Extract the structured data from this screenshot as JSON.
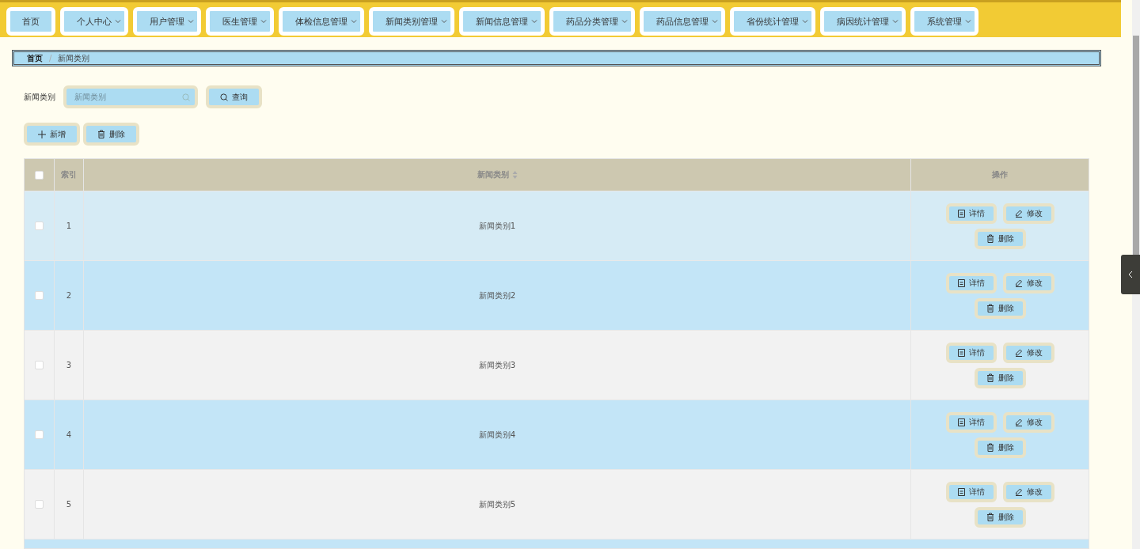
{
  "nav": [
    {
      "label": "首页",
      "has_menu": false
    },
    {
      "label": "个人中心",
      "has_menu": true
    },
    {
      "label": "用户管理",
      "has_menu": true
    },
    {
      "label": "医生管理",
      "has_menu": true
    },
    {
      "label": "体检信息管理",
      "has_menu": true
    },
    {
      "label": "新闻类别管理",
      "has_menu": true
    },
    {
      "label": "新闻信息管理",
      "has_menu": true
    },
    {
      "label": "药品分类管理",
      "has_menu": true
    },
    {
      "label": "药品信息管理",
      "has_menu": true
    },
    {
      "label": "省份统计管理",
      "has_menu": true
    },
    {
      "label": "病因统计管理",
      "has_menu": true
    },
    {
      "label": "系统管理",
      "has_menu": true
    }
  ],
  "breadcrumb": [
    "首页",
    "新闻类别"
  ],
  "breadcrumb_separator": "/",
  "search": {
    "label": "新闻类别",
    "placeholder": "新闻类别",
    "button": "查询"
  },
  "toolbar": [
    {
      "kind": "add",
      "label": "新增"
    },
    {
      "kind": "delete",
      "label": "删除"
    }
  ],
  "table": {
    "header_checked": false,
    "columns": [
      "索引",
      "新闻类别",
      "操作"
    ],
    "rows": [
      {
        "checked": false,
        "index": "1",
        "name": "新闻类别1",
        "actions": [
          {
            "kind": "detail",
            "label": "详情"
          },
          {
            "kind": "edit",
            "label": "修改"
          },
          {
            "kind": "delete",
            "label": "删除"
          }
        ]
      },
      {
        "checked": false,
        "index": "2",
        "name": "新闻类别2",
        "actions": [
          {
            "kind": "detail",
            "label": "详情"
          },
          {
            "kind": "edit",
            "label": "修改"
          },
          {
            "kind": "delete",
            "label": "删除"
          }
        ]
      },
      {
        "checked": false,
        "index": "3",
        "name": "新闻类别3",
        "actions": [
          {
            "kind": "detail",
            "label": "详情"
          },
          {
            "kind": "edit",
            "label": "修改"
          },
          {
            "kind": "delete",
            "label": "删除"
          }
        ]
      },
      {
        "checked": false,
        "index": "4",
        "name": "新闻类别4",
        "actions": [
          {
            "kind": "detail",
            "label": "详情"
          },
          {
            "kind": "edit",
            "label": "修改"
          },
          {
            "kind": "delete",
            "label": "删除"
          }
        ]
      },
      {
        "checked": false,
        "index": "5",
        "name": "新闻类别5",
        "actions": [
          {
            "kind": "detail",
            "label": "详情"
          },
          {
            "kind": "edit",
            "label": "修改"
          },
          {
            "kind": "delete",
            "label": "删除"
          }
        ]
      }
    ]
  }
}
